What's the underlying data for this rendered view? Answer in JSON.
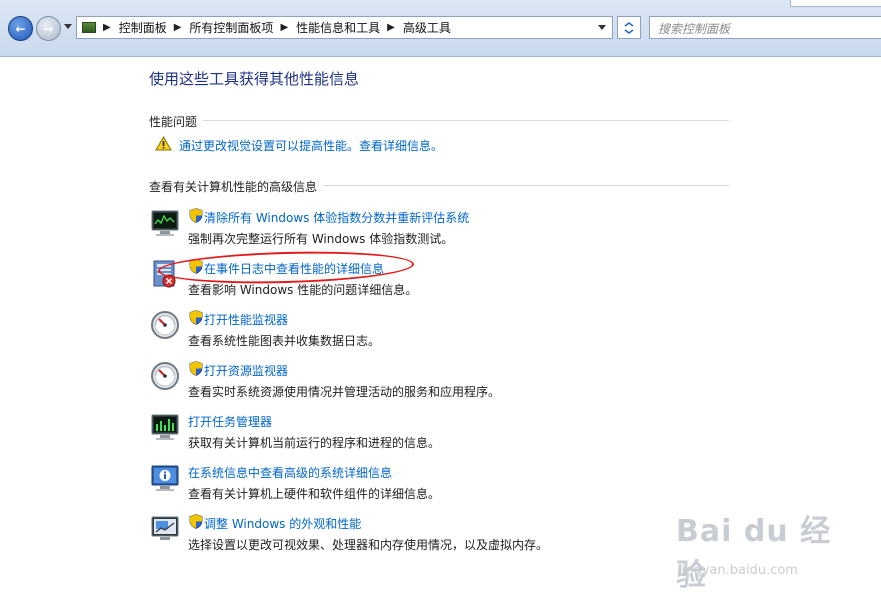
{
  "address_bar": {
    "breadcrumbs": [
      "控制面板",
      "所有控制面板项",
      "性能信息和工具",
      "高级工具"
    ],
    "search_placeholder": "搜索控制面板"
  },
  "main": {
    "title": "使用这些工具获得其他性能信息",
    "performance_issues": {
      "heading": "性能问题",
      "items": [
        {
          "link": "通过更改视觉设置可以提高性能。查看详细信息。",
          "icon": "warning-icon"
        }
      ]
    },
    "advanced_info": {
      "heading": "查看有关计算机性能的高级信息",
      "tools": [
        {
          "link": "清除所有 Windows 体验指数分数并重新评估系统",
          "desc": "强制再次完整运行所有 Windows 体验指数测试。",
          "icon": "performance-monitor-icon",
          "shield": true
        },
        {
          "link": "在事件日志中查看性能的详细信息",
          "desc": "查看影响 Windows 性能的问题详细信息。",
          "icon": "event-log-icon",
          "shield": true
        },
        {
          "link": "打开性能监视器",
          "desc": "查看系统性能图表并收集数据日志。",
          "icon": "gauge-icon",
          "shield": true
        },
        {
          "link": "打开资源监视器",
          "desc": "查看实时系统资源使用情况并管理活动的服务和应用程序。",
          "icon": "gauge-icon",
          "shield": true
        },
        {
          "link": "打开任务管理器",
          "desc": "获取有关计算机当前运行的程序和进程的信息。",
          "icon": "task-manager-icon",
          "shield": false
        },
        {
          "link": "在系统信息中查看高级的系统详细信息",
          "desc": "查看有关计算机上硬件和软件组件的详细信息。",
          "icon": "system-info-icon",
          "shield": false
        },
        {
          "link": "调整 Windows 的外观和性能",
          "desc": "选择设置以更改可视效果、处理器和内存使用情况，以及虚拟内存。",
          "icon": "appearance-icon",
          "shield": true
        }
      ]
    }
  },
  "watermark": {
    "main": "Bai du 经验",
    "sub": "jingyan.baidu.com"
  },
  "colors": {
    "link": "#0066cc",
    "title": "#1e3287",
    "highlight_circle": "#e21c1c"
  }
}
